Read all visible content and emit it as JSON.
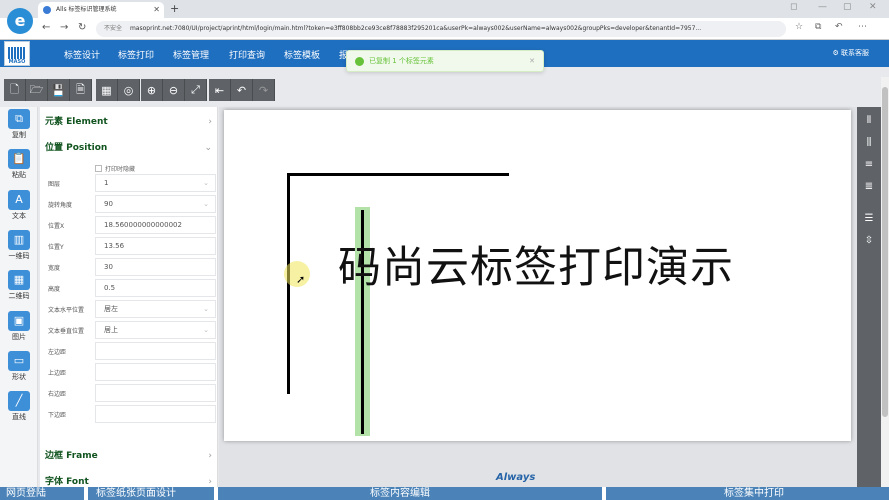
{
  "browser": {
    "tab_title": "Alls 标签标识管理系统",
    "url_insecure": "不安全",
    "url": "masoprint.net:7080/UI/project/aprint/html/login/main.html?token=e3ff808bb2ce93ce8f78883f295201ca&userPk=always002&userName=always002&groupPks=developer&tenantId=7957..."
  },
  "app": {
    "logo_text": "MASO",
    "menu": [
      "标签设计",
      "标签打印",
      "标签管理",
      "打印查询",
      "标签模板",
      "报"
    ],
    "support": "联系客服"
  },
  "toast": {
    "message": "已复制 1 个标签元素"
  },
  "leftbar": [
    {
      "label": "复制",
      "icon": "copy-icon"
    },
    {
      "label": "粘贴",
      "icon": "paste-icon"
    },
    {
      "label": "文本",
      "icon": "text-icon"
    },
    {
      "label": "一维码",
      "icon": "barcode-icon"
    },
    {
      "label": "二维码",
      "icon": "qrcode-icon"
    },
    {
      "label": "图片",
      "icon": "image-icon"
    },
    {
      "label": "形状",
      "icon": "shape-icon"
    },
    {
      "label": "直线",
      "icon": "line-icon"
    }
  ],
  "props": {
    "section_element": "元素 Element",
    "section_position": "位置 Position",
    "print_hidden": "打印时隐藏",
    "fields": [
      {
        "label": "图层",
        "value": "1",
        "dropdown": true
      },
      {
        "label": "旋转角度",
        "value": "90",
        "dropdown": true
      },
      {
        "label": "位置X",
        "value": "18.560000000000002",
        "dropdown": false
      },
      {
        "label": "位置Y",
        "value": "13.56",
        "dropdown": false
      },
      {
        "label": "宽度",
        "value": "30",
        "dropdown": false
      },
      {
        "label": "高度",
        "value": "0.5",
        "dropdown": false
      },
      {
        "label": "文本水平位置",
        "value": "居左",
        "dropdown": true
      },
      {
        "label": "文本垂直位置",
        "value": "居上",
        "dropdown": true
      },
      {
        "label": "左边距",
        "value": "",
        "dropdown": false
      },
      {
        "label": "上边距",
        "value": "",
        "dropdown": false
      },
      {
        "label": "右边距",
        "value": "",
        "dropdown": false
      },
      {
        "label": "下边距",
        "value": "",
        "dropdown": false
      }
    ],
    "section_frame": "边框 Frame",
    "section_font": "字体 Font"
  },
  "canvas": {
    "label_text": "码尚云标签打印演示"
  },
  "watermark": "Always",
  "bottom": {
    "items": [
      "网页登陆",
      "标签纸张页面设计",
      "标签内容编辑",
      "标签集中打印"
    ]
  }
}
